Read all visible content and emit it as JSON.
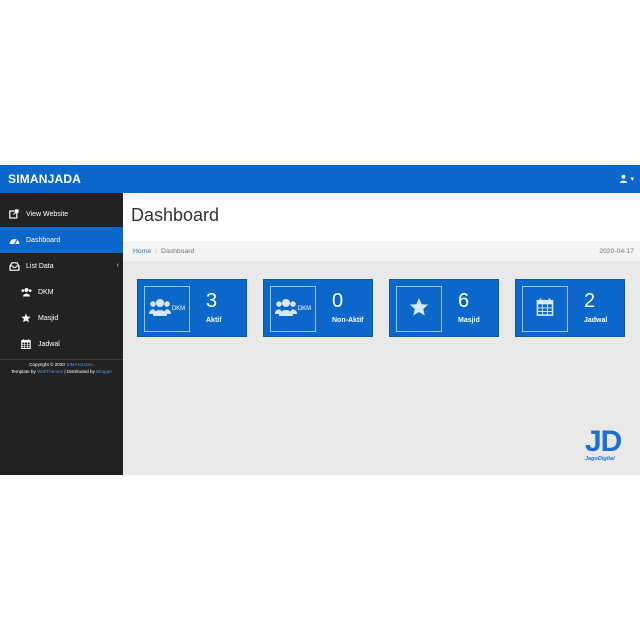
{
  "app": {
    "brand": "SIMANJADA"
  },
  "colors": {
    "primary": "#0b67c9",
    "sidebar": "#222222",
    "content_bg": "#e9e9e9"
  },
  "header": {
    "user_icon": "user-icon",
    "caret": "▾"
  },
  "sidebar": {
    "items": [
      {
        "label": "View Website",
        "icon": "external-link-icon"
      },
      {
        "label": "Dashboard",
        "icon": "dashboard-icon",
        "active": true
      },
      {
        "label": "List Data",
        "icon": "inbox-icon",
        "caret": "‹"
      },
      {
        "label": "DKM",
        "icon": "users-icon"
      },
      {
        "label": "Masjid",
        "icon": "star-icon"
      },
      {
        "label": "Jadwal",
        "icon": "calendar-icon"
      }
    ],
    "footer": {
      "copyright": "Copyright © 2020",
      "copyright_link": "SIMANJADA",
      "copyright_end": ".",
      "template_prefix": "Template by",
      "template_link": "WebThemez",
      "distributed_prefix": "| Distributed by",
      "distributed_link": "Blogger"
    }
  },
  "page": {
    "title": "Dashboard",
    "breadcrumb": {
      "home": "Home",
      "separator": "/",
      "current": "Dashboard"
    },
    "date": "2020-04-17"
  },
  "cards": [
    {
      "icon": "users-icon",
      "icon_label": "DKM",
      "value": "3",
      "label": "Aktif"
    },
    {
      "icon": "users-icon",
      "icon_label": "DKM",
      "value": "0",
      "label": "Non-Aktif"
    },
    {
      "icon": "star-icon",
      "icon_label": "",
      "value": "6",
      "label": "Masjid"
    },
    {
      "icon": "calendar-icon",
      "icon_label": "",
      "value": "2",
      "label": "Jadwal"
    }
  ],
  "watermark": {
    "logo": "JD",
    "text": "JagoDigital"
  }
}
